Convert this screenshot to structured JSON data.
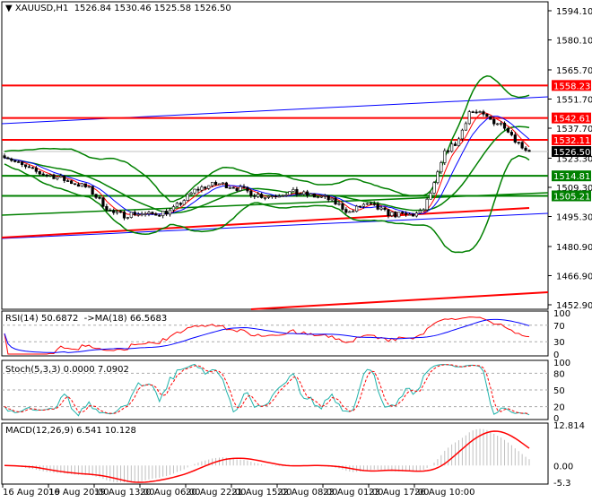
{
  "header": {
    "symbol": "XAUUSD,H1",
    "open": "1526.84",
    "high": "1530.46",
    "low": "1525.58",
    "close": "1526.50"
  },
  "chart_data": {
    "type": "candlestick",
    "price_axis": {
      "ylim": [
        1452.9,
        1594.1
      ],
      "ticks": [
        "1594.10",
        "1580.10",
        "1565.70",
        "1551.70",
        "1537.70",
        "1523.30",
        "1509.30",
        "1495.30",
        "1480.90",
        "1466.90",
        "1452.90"
      ]
    },
    "levels": [
      {
        "label": "1558.23",
        "value": 1558.23,
        "color": "#ff0000"
      },
      {
        "label": "1542.61",
        "value": 1542.61,
        "color": "#ff0000"
      },
      {
        "label": "1532.11",
        "value": 1532.11,
        "color": "#ff0000"
      },
      {
        "label": "1514.81",
        "value": 1514.81,
        "color": "#008000"
      },
      {
        "label": "1505.21",
        "value": 1505.21,
        "color": "#008000"
      }
    ],
    "current_price": {
      "label": "1526.50",
      "value": 1526.5
    },
    "close_path": [
      1525,
      1521,
      1518,
      1516,
      1515,
      1513,
      1511,
      1509,
      1503,
      1497,
      1496,
      1497,
      1496,
      1497,
      1498,
      1503,
      1508,
      1510,
      1511,
      1510,
      1508,
      1506,
      1505,
      1506,
      1507,
      1506,
      1505,
      1504,
      1501,
      1497,
      1501,
      1500,
      1497,
      1496,
      1496,
      1497,
      1510,
      1527,
      1531,
      1546,
      1544,
      1541,
      1539,
      1531,
      1526.5
    ],
    "time_labels": [
      "16 Aug 2019",
      "16 Aug 20:00",
      "19 Aug 13:00",
      "20 Aug 06:00",
      "20 Aug 22:00",
      "21 Aug 15:00",
      "22 Aug 08:00",
      "23 Aug 01:00",
      "23 Aug 17:00",
      "26 Aug 10:00"
    ],
    "rsi": {
      "title": "RSI(14) 50.6872  ->MA(18) 66.5683",
      "ticks": [
        "100",
        "70",
        "30",
        "0"
      ],
      "ylim": [
        0,
        100
      ],
      "levels": [
        70,
        30
      ]
    },
    "stoch": {
      "title": "Stoch(5,3,3) 0.0000 7.0902",
      "ticks": [
        "100",
        "80",
        "50",
        "20",
        "0"
      ],
      "ylim": [
        0,
        100
      ],
      "levels": [
        80,
        50,
        20
      ]
    },
    "macd": {
      "title": "MACD(12,26,9) 6.541 10.128",
      "ticks": [
        "12.814",
        "0.00",
        "-5.3"
      ],
      "ylim": [
        -5.3,
        12.814
      ]
    },
    "colors": {
      "up": "#000000",
      "down": "#000000",
      "levels_red": "#ff0000",
      "levels_green": "#008000",
      "trend_blue": "#0000ff",
      "bands": "#008000",
      "rsi": "#ff0000",
      "rsi_ma": "#0000ff",
      "stoch_main": "#20b2aa",
      "stoch_signal": "#ff0000",
      "macd_hist": "#c0c0c0",
      "macd_signal": "#ff0000"
    }
  }
}
